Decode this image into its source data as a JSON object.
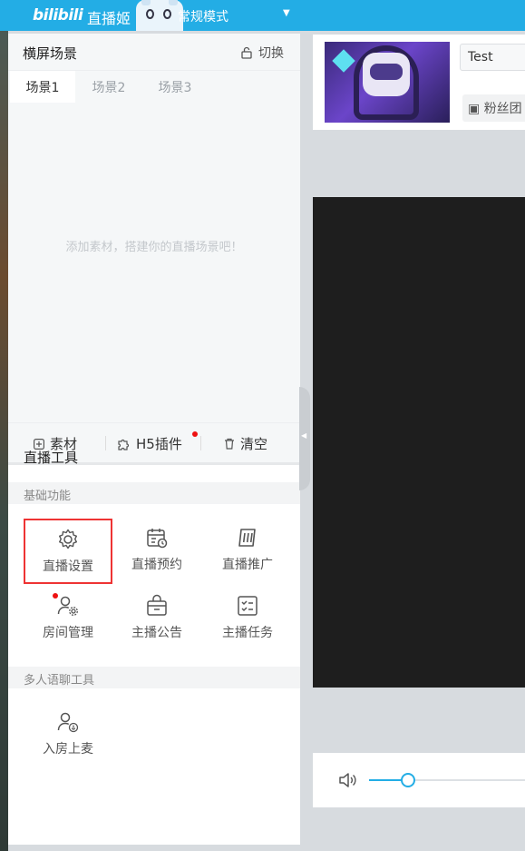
{
  "titlebar": {
    "logo": "bilibili",
    "app_name": "直播姬",
    "mode": "常规模式"
  },
  "scene": {
    "title": "横屏场景",
    "switch_label": "切换",
    "tabs": [
      {
        "label": "场景1",
        "active": true
      },
      {
        "label": "场景2",
        "active": false
      },
      {
        "label": "场景3",
        "active": false
      }
    ],
    "empty_text": "添加素材，搭建你的直播场景吧！",
    "actions": {
      "material": "素材",
      "h5_plugin": "H5插件",
      "clear": "清空"
    }
  },
  "tools": {
    "title": "直播工具",
    "basic_section": "基础功能",
    "basic": [
      {
        "label": "直播设置",
        "icon": "gear-icon",
        "selected": true
      },
      {
        "label": "直播预约",
        "icon": "calendar-clock-icon"
      },
      {
        "label": "直播推广",
        "icon": "promotion-icon"
      },
      {
        "label": "房间管理",
        "icon": "user-gear-icon",
        "has_dot": true
      },
      {
        "label": "主播公告",
        "icon": "announcement-icon"
      },
      {
        "label": "主播任务",
        "icon": "checklist-icon"
      }
    ],
    "multi_section": "多人语聊工具",
    "multi": [
      {
        "label": "入房上麦",
        "icon": "user-mic-icon"
      }
    ]
  },
  "room": {
    "title_value": "Test",
    "fans_label": "粉丝团"
  },
  "volume": {
    "level": 0.5
  },
  "colors": {
    "brand": "#23ade5",
    "highlight_border": "#ee3333",
    "notify_dot": "#ee1111"
  }
}
